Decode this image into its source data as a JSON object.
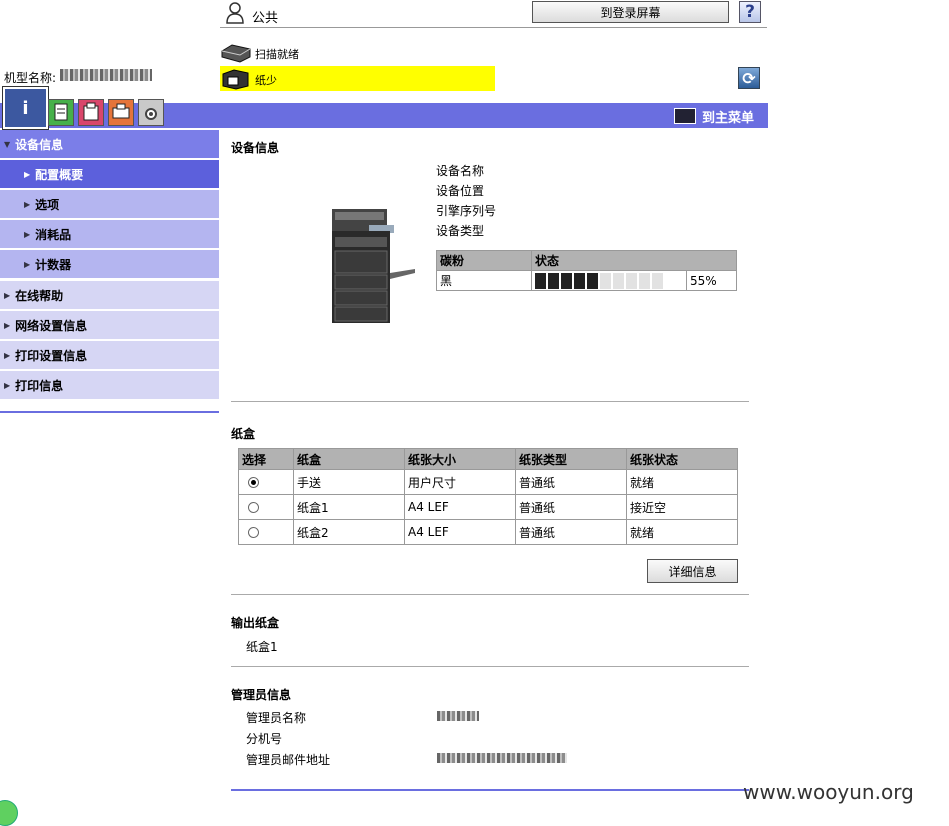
{
  "header": {
    "user_label": "公共",
    "login_button": "到登录屏幕",
    "help_button": "?"
  },
  "status": {
    "scan_text": "扫描就绪",
    "paper_text": "纸少",
    "paper_bg_color": "#ffff00"
  },
  "model": {
    "label": "机型名称:"
  },
  "tabs": [
    "info-icon",
    "job-icon",
    "box-icon",
    "print-icon",
    "settings-icon"
  ],
  "band": {
    "main_menu": "到主菜单",
    "color": "#6a6ee0"
  },
  "sidebar": {
    "items": [
      {
        "label": "设备信息"
      },
      {
        "label": "配置概要"
      },
      {
        "label": "选项"
      },
      {
        "label": "消耗品"
      },
      {
        "label": "计数器"
      },
      {
        "label": "在线帮助"
      },
      {
        "label": "网络设置信息"
      },
      {
        "label": "打印设置信息"
      },
      {
        "label": "打印信息"
      }
    ]
  },
  "device": {
    "title": "设备信息",
    "fields": [
      "设备名称",
      "设备位置",
      "引擎序列号",
      "设备类型"
    ],
    "toner_headers": [
      "碳粉",
      "状态"
    ],
    "toner_color": "黑",
    "toner_level_percent": 55,
    "toner_level_text": "55%"
  },
  "trays": {
    "title": "纸盒",
    "headers": [
      "选择",
      "纸盒",
      "纸张大小",
      "纸张类型",
      "纸张状态"
    ],
    "rows": [
      {
        "selected": true,
        "tray": "手送",
        "size": "用户尺寸",
        "type": "普通纸",
        "state": "就绪"
      },
      {
        "selected": false,
        "tray": "纸盒1",
        "size": "A4 LEF",
        "type": "普通纸",
        "state": "接近空"
      },
      {
        "selected": false,
        "tray": "纸盒2",
        "size": "A4 LEF",
        "type": "普通纸",
        "state": "就绪"
      }
    ],
    "detail_button": "详细信息"
  },
  "output": {
    "title": "输出纸盒",
    "value": "纸盒1"
  },
  "admin": {
    "title": "管理员信息",
    "fields": [
      "管理员名称",
      "分机号",
      "管理员邮件地址"
    ]
  },
  "watermark": "www.wooyun.org"
}
